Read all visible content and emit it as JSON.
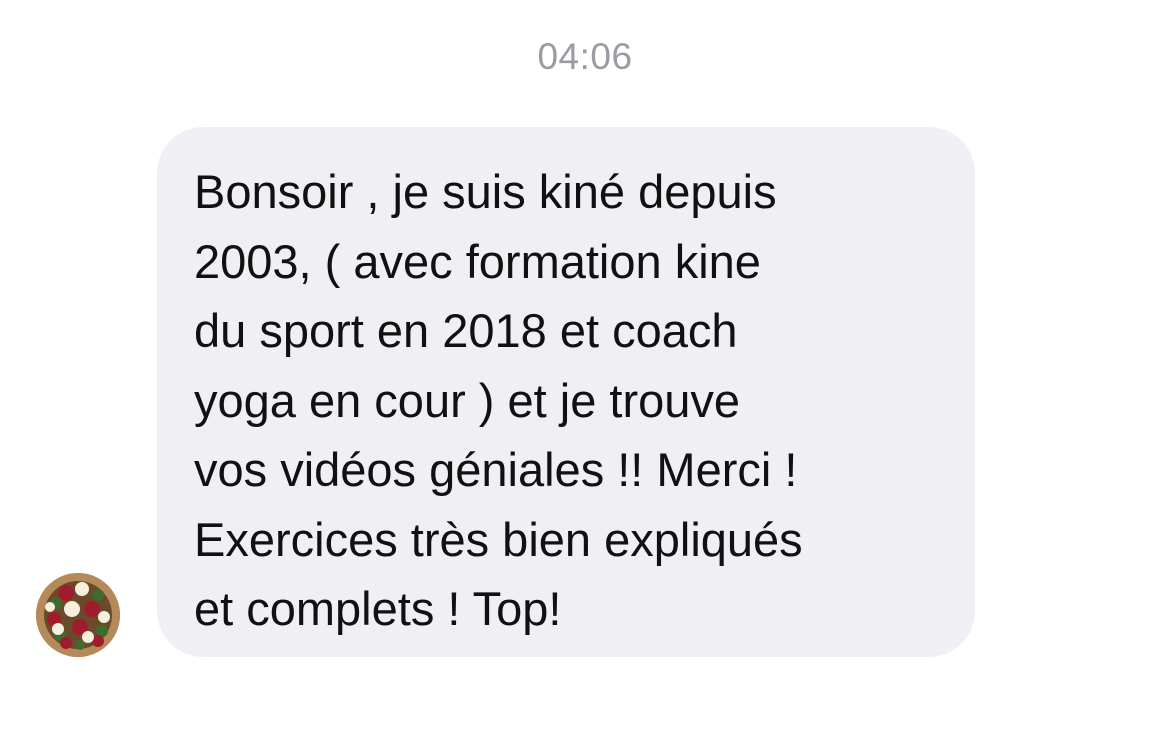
{
  "conversation": {
    "timestamp": "04:06",
    "message": {
      "text": "Bonsoir , je suis kiné depuis\n2003, ( avec formation kine\ndu sport en 2018 et coach\nyoga en cour ) et je trouve\nvos vidéos géniales !! Merci !\nExercices très bien expliqués\net complets ! Top!",
      "bubble_color": "#f0f0f4",
      "text_color": "#111111"
    },
    "avatar": {
      "icon": "flower-bouquet-avatar",
      "colors": [
        "#b58a5a",
        "#a01c2c",
        "#f4f0dc",
        "#3f6b2e"
      ]
    }
  }
}
